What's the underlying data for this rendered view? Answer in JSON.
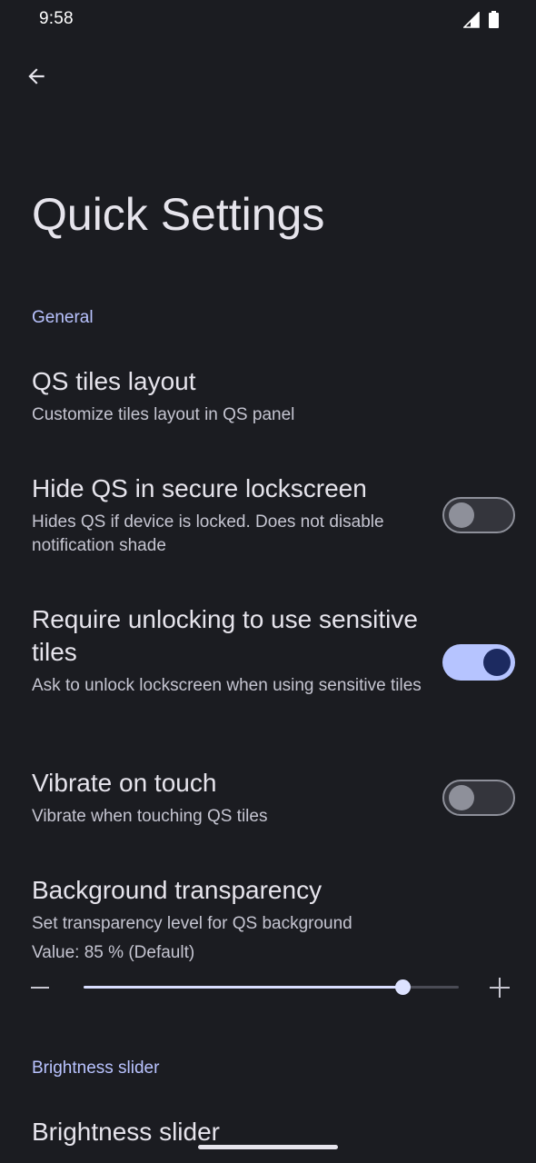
{
  "status_bar": {
    "time": "9:58",
    "icons": [
      "signal-icon",
      "battery-icon"
    ]
  },
  "toolbar": {
    "back_icon": "arrow-back-icon"
  },
  "page": {
    "title": "Quick Settings"
  },
  "sections": {
    "general": {
      "header": "General",
      "qs_tiles_layout": {
        "title": "QS tiles layout",
        "summary": "Customize tiles layout in QS panel"
      },
      "hide_qs": {
        "title": "Hide QS in secure lockscreen",
        "summary": "Hides QS if device is locked. Does not disable notification shade",
        "enabled": false
      },
      "require_unlock": {
        "title": "Require unlocking to use sensitive tiles",
        "summary": "Ask to unlock lockscreen when using sensitive tiles",
        "enabled": true
      },
      "vibrate": {
        "title": "Vibrate on touch",
        "summary": "Vibrate when touching QS tiles",
        "enabled": false
      },
      "background_transparency": {
        "title": "Background transparency",
        "summary": "Set transparency level for QS background",
        "value_text": "Value: 85 % (Default)",
        "value": 85,
        "min": 0,
        "max": 100
      }
    },
    "brightness": {
      "header": "Brightness slider",
      "brightness_slider": {
        "title": "Brightness slider"
      }
    }
  },
  "colors": {
    "background": "#1b1c21",
    "accent": "#b9c3ff",
    "switch_on_track": "#b6c4ff",
    "switch_on_thumb": "#1c2a60"
  }
}
